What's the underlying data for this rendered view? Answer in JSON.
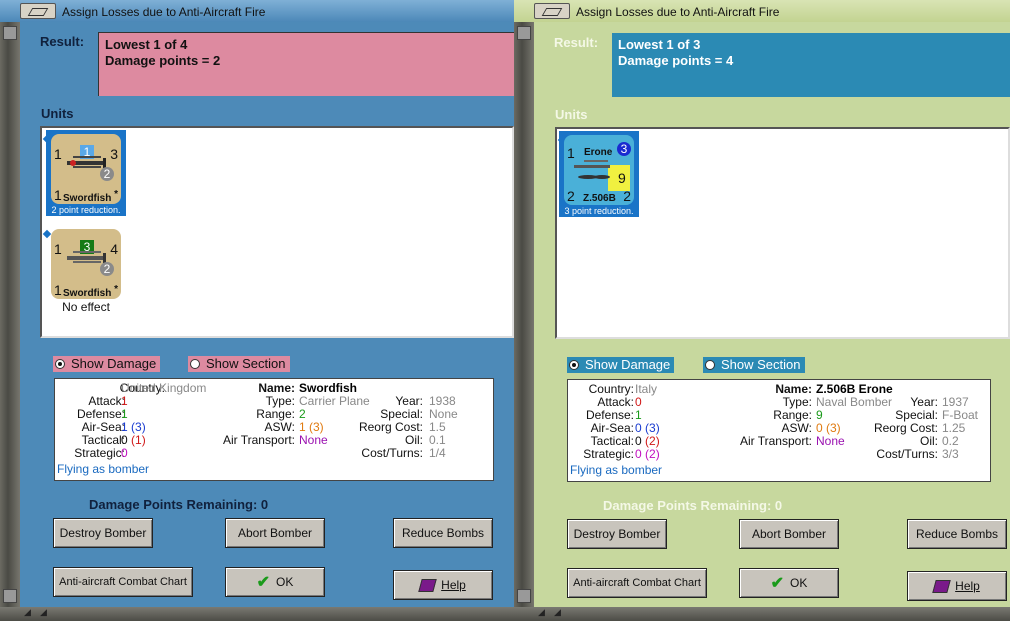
{
  "left": {
    "title": "Assign Losses due to Anti-Aircraft Fire",
    "result_label": "Result:",
    "result_line1": "Lowest 1 of 4",
    "result_line2": "Damage points = 2",
    "units_label": "Units",
    "units": [
      {
        "name": "Swordfish",
        "tl": "1",
        "badge": "1",
        "tr": "3",
        "circle": "2",
        "bl": "1",
        "star": "*",
        "note": "2 point reduction.",
        "selected": true
      },
      {
        "name": "Swordfish",
        "tl": "1",
        "badge": "3",
        "tr": "4",
        "circle": "2",
        "bl": "1",
        "star": "*",
        "note": "No effect",
        "selected": false
      }
    ],
    "show_damage": "Show Damage",
    "show_section": "Show Section",
    "info": {
      "country_k": "Country:",
      "country": "United Kingdom",
      "attack_k": "Attack:",
      "attack": "1",
      "defense_k": "Defense:",
      "defense": "1",
      "airsea_k": "Air-Sea:",
      "airsea_a": "1",
      "airsea_b": "(3)",
      "tactical_k": "Tactical:",
      "tactical_a": "0",
      "tactical_b": "(1)",
      "strategic_k": "Strategic:",
      "strategic": "0",
      "flying": "Flying as bomber",
      "name_k": "Name:",
      "name": "Swordfish",
      "type_k": "Type:",
      "type": "Carrier Plane",
      "year_k": "Year:",
      "year": "1938",
      "range_k": "Range:",
      "range": "2",
      "special_k": "Special:",
      "special": "None",
      "asw_k": "ASW:",
      "asw": "1 (3)",
      "reorg_k": "Reorg Cost:",
      "reorg": "1.5",
      "airtrans_k": "Air Transport:",
      "airtrans": "None",
      "oil_k": "Oil:",
      "oil": "0.1",
      "cost_k": "Cost/Turns:",
      "cost": "1/4"
    },
    "damage_remaining": "Damage Points Remaining:  0",
    "buttons": {
      "destroy": "Destroy Bomber",
      "abort": "Abort Bomber",
      "reduce": "Reduce Bombs",
      "chart": "Anti-aircraft Combat Chart",
      "ok": "OK",
      "help": "Help"
    }
  },
  "right": {
    "title": "Assign Losses due to Anti-Aircraft Fire",
    "result_label": "Result:",
    "result_line1": "Lowest 1 of 3",
    "result_line2": "Damage points = 4",
    "units_label": "Units",
    "units": [
      {
        "name": "Z.506B",
        "tl": "1",
        "top": "Erone",
        "badge": "3",
        "mid": "9",
        "bl": "2",
        "br": "2",
        "note": "3 point reduction.",
        "selected": true
      }
    ],
    "show_damage": "Show Damage",
    "show_section": "Show Section",
    "info": {
      "country_k": "Country:",
      "country": "Italy",
      "attack_k": "Attack:",
      "attack": "0",
      "defense_k": "Defense:",
      "defense": "1",
      "airsea_k": "Air-Sea:",
      "airsea_a": "0",
      "airsea_b": "(3)",
      "tactical_k": "Tactical:",
      "tactical_a": "0",
      "tactical_b": "(2)",
      "strategic_k": "Strategic:",
      "strategic_a": "0",
      "strategic_b": "(2)",
      "flying": "Flying as bomber",
      "name_k": "Name:",
      "name": "Z.506B Erone",
      "type_k": "Type:",
      "type": "Naval Bomber",
      "year_k": "Year:",
      "year": "1937",
      "range_k": "Range:",
      "range": "9",
      "special_k": "Special:",
      "special": "F-Boat",
      "asw_k": "ASW:",
      "asw": "0 (3)",
      "reorg_k": "Reorg Cost:",
      "reorg": "1.25",
      "airtrans_k": "Air Transport:",
      "airtrans": "None",
      "oil_k": "Oil:",
      "oil": "0.2",
      "cost_k": "Cost/Turns:",
      "cost": "3/3"
    },
    "damage_remaining": "Damage Points Remaining:  0",
    "buttons": {
      "destroy": "Destroy Bomber",
      "abort": "Abort Bomber",
      "reduce": "Reduce Bombs",
      "chart": "Anti-aircraft Combat Chart",
      "ok": "OK",
      "help": "Help"
    }
  },
  "colors": {
    "left_bg": "#4d8ab8",
    "right_bg": "#c7d89e",
    "left_accent": "#dd8aa0",
    "right_accent": "#2b8ab4",
    "selection": "#1a74c7"
  }
}
